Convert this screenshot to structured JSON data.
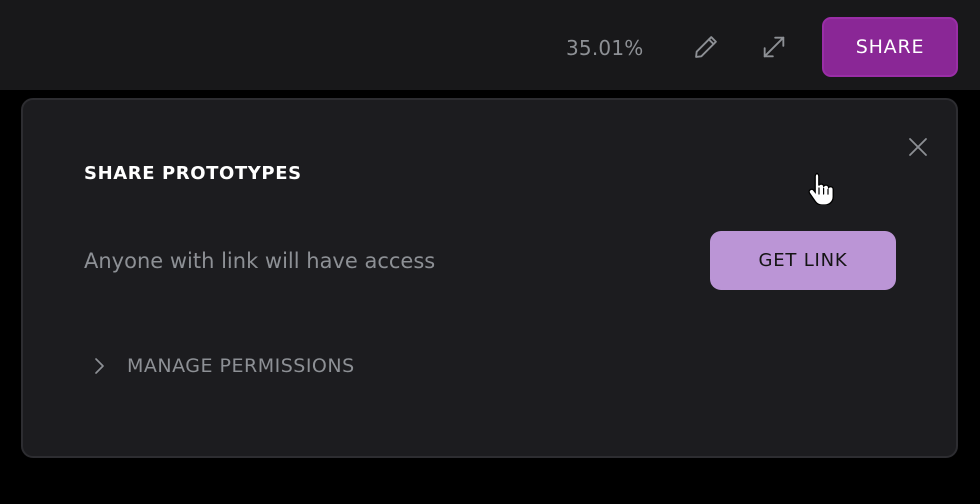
{
  "toolbar": {
    "zoom_text": "35.01%",
    "edit_icon": "pencil-icon",
    "expand_icon": "expand-arrows-icon",
    "share_label": "SHARE",
    "share_color": "#8a2796"
  },
  "share_dialog": {
    "close_icon": "close-icon",
    "title": "SHARE PROTOTYPES",
    "description": "Anyone with link will have access",
    "get_link_label": "GET LINK",
    "get_link_color": "#bb95d6",
    "manage_icon": "chevron-right-icon",
    "manage_label": "MANAGE PERMISSIONS",
    "cursor_icon": "hand-pointer-icon"
  }
}
